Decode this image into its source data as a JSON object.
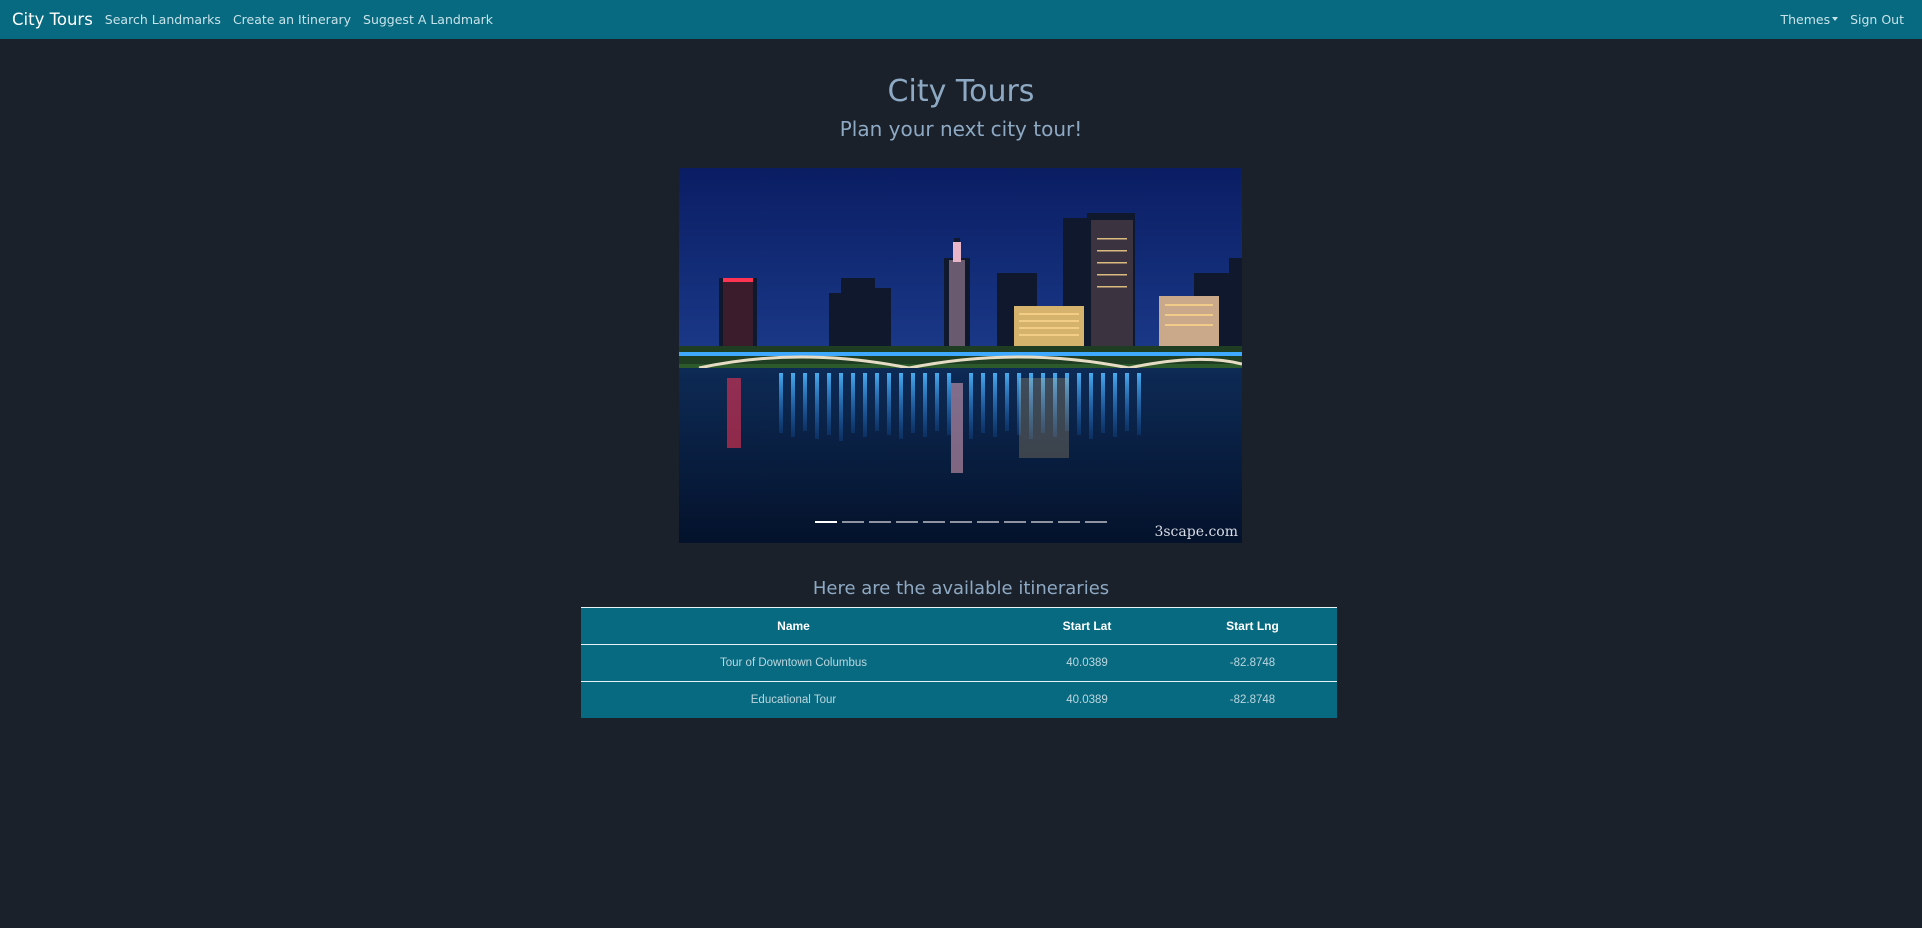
{
  "navbar": {
    "brand": "City Tours",
    "links": [
      "Search Landmarks",
      "Create an Itinerary",
      "Suggest A Landmark"
    ],
    "themes_label": "Themes",
    "signout_label": "Sign Out"
  },
  "header": {
    "title": "City Tours",
    "subtitle": "Plan your next city tour!"
  },
  "carousel": {
    "image_alt": "Columbus skyline at night",
    "watermark": "3scape.com",
    "slide_count": 11,
    "active_index": 0
  },
  "itineraries": {
    "heading": "Here are the available itineraries",
    "columns": [
      "Name",
      "Start Lat",
      "Start Lng"
    ],
    "rows": [
      {
        "name": "Tour of Downtown Columbus",
        "lat": "40.0389",
        "lng": "-82.8748"
      },
      {
        "name": "Educational Tour",
        "lat": "40.0389",
        "lng": "-82.8748"
      }
    ]
  },
  "colors": {
    "navbar": "#076a80",
    "background": "#1b212a",
    "heading": "#8ea9c4"
  }
}
